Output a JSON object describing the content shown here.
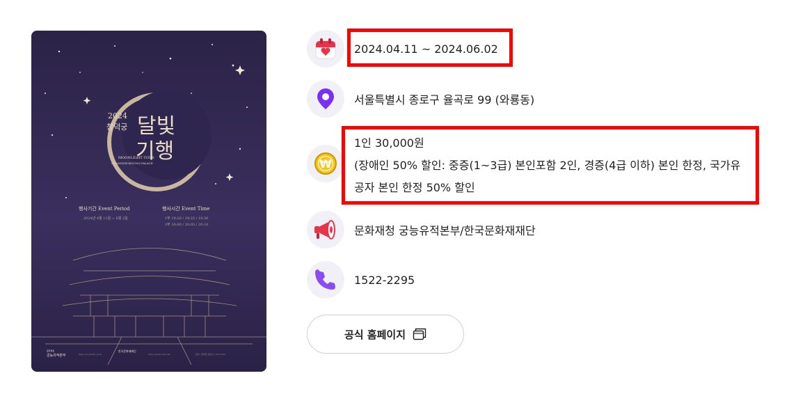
{
  "poster": {
    "year": "2024",
    "subtitle": "창덕궁",
    "title_line1": "달빛",
    "title_line2": "기행",
    "english_title": "MOONLIGHT TOUR",
    "english_sub": "CHANGDEOKGUNG PALACE",
    "event_period_label": "행사기간  Event Period",
    "event_period_value": "2024년 4월 11일 ~ 6월 2일",
    "event_time_label": "행사시간  Event Time",
    "event_time_value1": "1부  19:20 / 19:25 / 19:30",
    "event_time_value2": "2부  20:00 / 20:05 / 20:10",
    "org1": "궁능유적본부",
    "org1_small": "문화재청",
    "org2": "한국문화재재단",
    "url1": "https://royal.khs.go.kr",
    "url2": "https://www.chf.or.kr",
    "contact": "문의 | 창덕궁 관리소 1522-2295"
  },
  "info": {
    "date": "2024.04.11 ~ 2024.06.02",
    "address": "서울특별시 종로구 율곡로 99 (와룡동)",
    "price_line1": "1인 30,000원",
    "price_line2": "(장애인 50% 할인: 중증(1~3급) 본인포함 2인, 경증(4급 이하) 본인 한정, 국가유",
    "price_line3": "공자 본인 한정 50% 할인",
    "organizer": "문화재청 궁능유적본부/한국문화재재단",
    "phone": "1522-2295"
  },
  "buttons": {
    "homepage": "공식 홈페이지"
  },
  "colors": {
    "highlight": "#ff0000",
    "icon_bg": "#f1f0f6",
    "location_purple": "#7b2ff2",
    "phone_purple": "#8a4cf0",
    "coin_yellow": "#f5c518",
    "calendar_red": "#e8344a"
  }
}
